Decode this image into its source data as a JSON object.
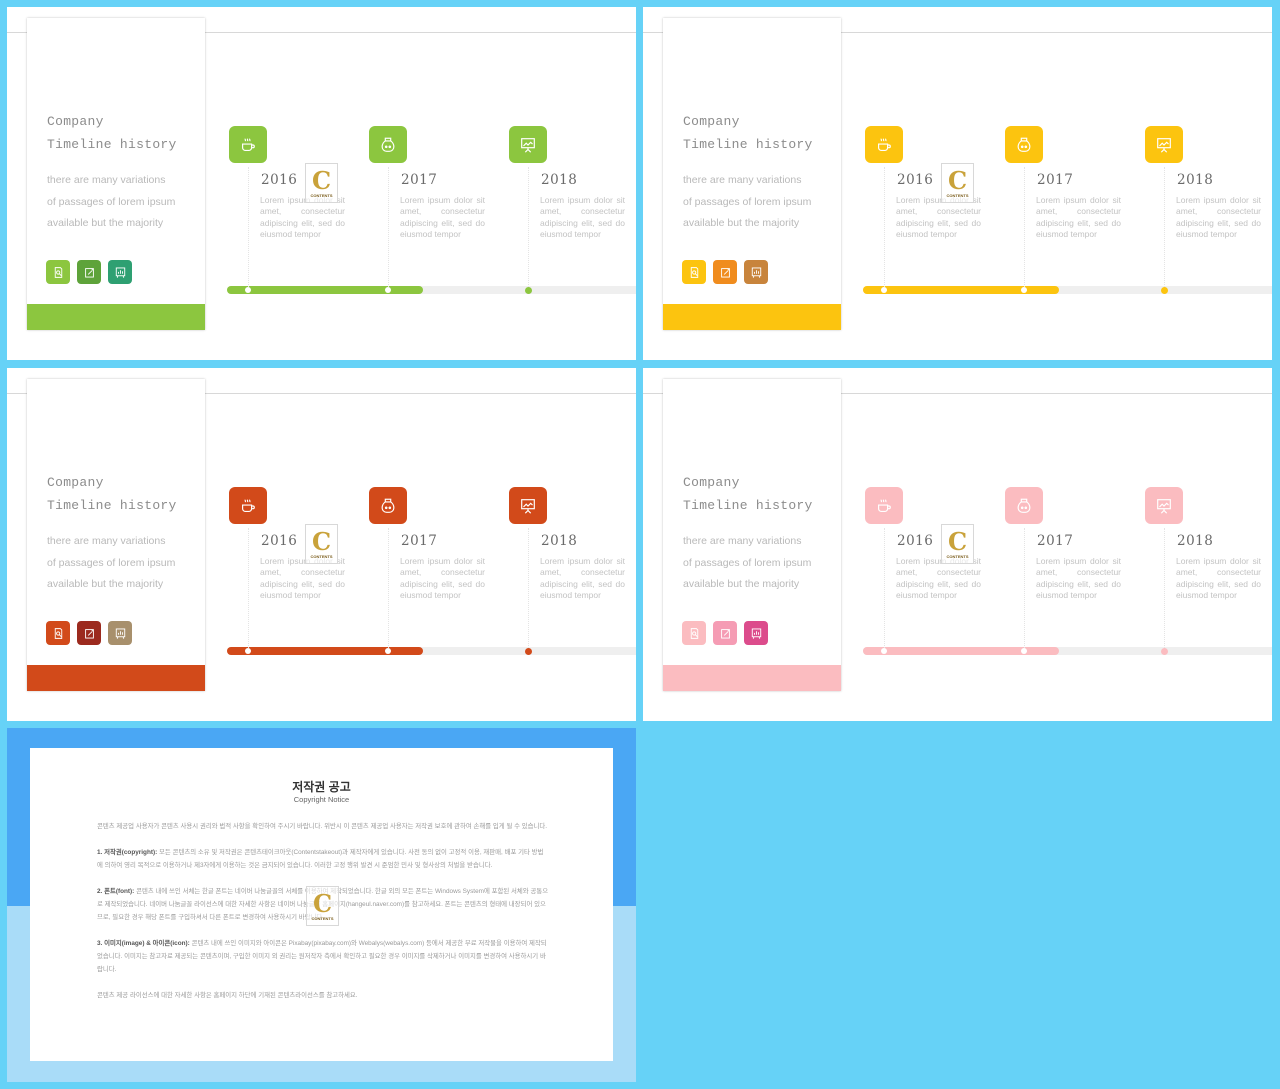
{
  "slides": [
    {
      "theme": "green",
      "accent": "#8cc63f",
      "band_color": "#8cc63f",
      "mini_colors": [
        "#8cc63f",
        "#5ea33a",
        "#2ea072"
      ],
      "title_line1": "Company",
      "title_line2": "Timeline history",
      "description": [
        "there are many variations",
        "of passages of lorem ipsum",
        "available but the majority"
      ],
      "progress_percent": 48,
      "milestones": [
        {
          "year": "2016",
          "icon": "coffee-cup-icon",
          "text": "Lorem ipsum dolor sit amet, consectetur adipiscing elit, sed do eiusmod tempor"
        },
        {
          "year": "2017",
          "icon": "jar-icon",
          "text": "Lorem ipsum dolor sit amet, consectetur adipiscing elit, sed do eiusmod tempor"
        },
        {
          "year": "2018",
          "icon": "presentation-board-icon",
          "text": "Lorem ipsum dolor sit amet, consectetur adipiscing elit, sed do eiusmod tempor"
        }
      ]
    },
    {
      "theme": "yellow",
      "accent": "#fcc40f",
      "band_color": "#fcc40f",
      "mini_colors": [
        "#fcc40f",
        "#f08c1e",
        "#c8843c"
      ],
      "title_line1": "Company",
      "title_line2": "Timeline history",
      "description": [
        "there are many variations",
        "of passages of lorem ipsum",
        "available but the majority"
      ],
      "progress_percent": 48,
      "milestones": [
        {
          "year": "2016",
          "icon": "coffee-cup-icon",
          "text": "Lorem ipsum dolor sit amet, consectetur adipiscing elit, sed do eiusmod tempor"
        },
        {
          "year": "2017",
          "icon": "jar-icon",
          "text": "Lorem ipsum dolor sit amet, consectetur adipiscing elit, sed do eiusmod tempor"
        },
        {
          "year": "2018",
          "icon": "presentation-board-icon",
          "text": "Lorem ipsum dolor sit amet, consectetur adipiscing elit, sed do eiusmod tempor"
        }
      ]
    },
    {
      "theme": "orange-red",
      "accent": "#d24a1a",
      "band_color": "#d24a1a",
      "mini_colors": [
        "#d24a1a",
        "#9c2a1e",
        "#a8906c"
      ],
      "title_line1": "Company",
      "title_line2": "Timeline history",
      "description": [
        "there are many variations",
        "of passages of lorem ipsum",
        "available but the majority"
      ],
      "progress_percent": 48,
      "milestones": [
        {
          "year": "2016",
          "icon": "coffee-cup-icon",
          "text": "Lorem ipsum dolor sit amet, consectetur adipiscing elit, sed do eiusmod tempor"
        },
        {
          "year": "2017",
          "icon": "jar-icon",
          "text": "Lorem ipsum dolor sit amet, consectetur adipiscing elit, sed do eiusmod tempor"
        },
        {
          "year": "2018",
          "icon": "presentation-board-icon",
          "text": "Lorem ipsum dolor sit amet, consectetur adipiscing elit, sed do eiusmod tempor"
        }
      ]
    },
    {
      "theme": "pink",
      "accent": "#fbbcc0",
      "band_color": "#fbbcc0",
      "mini_colors": [
        "#fbbcc0",
        "#f59cb4",
        "#dc4c8c"
      ],
      "title_line1": "Company",
      "title_line2": "Timeline history",
      "description": [
        "there are many variations",
        "of passages of lorem ipsum",
        "available but the majority"
      ],
      "progress_percent": 48,
      "milestones": [
        {
          "year": "2016",
          "icon": "coffee-cup-icon",
          "text": "Lorem ipsum dolor sit amet, consectetur adipiscing elit, sed do eiusmod tempor"
        },
        {
          "year": "2017",
          "icon": "jar-icon",
          "text": "Lorem ipsum dolor sit amet, consectetur adipiscing elit, sed do eiusmod tempor"
        },
        {
          "year": "2018",
          "icon": "presentation-board-icon",
          "text": "Lorem ipsum dolor sit amet, consectetur adipiscing elit, sed do eiusmod tempor"
        }
      ]
    }
  ],
  "watermark": {
    "letter": "C",
    "text": "CONTENTS"
  },
  "copyright": {
    "title": "저작권 공고",
    "subtitle": "Copyright Notice",
    "intro": "콘텐츠 제공업 사용자가 콘텐츠 사용시 권리와 법적 사항을 확인하여 주시기 바랍니다. 위반시 이 콘텐츠 제공업 사용자는 저작권 보호에 관하여 손해를 입게 될 수 있습니다.",
    "sections": [
      {
        "label": "1. 저작권(copyright):",
        "text": "모든 콘텐츠의 소유 및 저작권은 콘텐츠테이크아웃(Contentstakeout)과 제작자에게 있습니다. 사전 동의 없이 고정적 이용, 재판매, 배포 기타 방법에 의하여 영리 목적으로 이용하거나 제3자에게 이용하는 것은 금지되어 있습니다. 이러한 고정 행위 발견 시 준엄한 민사 및 형사상의 처벌을 받습니다."
      },
      {
        "label": "2. 폰트(font):",
        "text": "콘텐츠 내에 쓰인 서체는 한글 폰트는 네이버 나눔글꼴의 서체를 이용하여 제작되었습니다. 한글 외의 모든 폰트는 Windows System에 포함된 서체와 공통으로 제작되었습니다. 네이버 나눔글꼴 라이선스에 대한 자세한 사항은 네이버 나눔글꼴 홈페이지(hangeul.naver.com)를 참고하세요. 폰트는 콘텐츠의 형태에 내장되어 있으므로, 필요한 경우 해당 폰트를 구입하셔서 다른 폰트로 변경하여 사용하시기 바랍니다."
      },
      {
        "label": "3. 이미지(image) & 아이콘(icon):",
        "text": "콘텐츠 내에 쓰인 이미지와 아이콘은 Pixabay(pixabay.com)와 Webalys(webalys.com) 등에서 제공한 무료 저작물을 이용하여 제작되었습니다. 이미지는 참고자료 제공되는 콘텐츠이며, 구입한 이미지 외 권리는 원저작자 측에서 확인하고 필요한 경우 이미지를 삭제하거나 이미지를 변경하여 사용하시기 바랍니다."
      }
    ],
    "footer": "콘텐츠 제공 라이선스에 대한 자세한 사항은 홈페이지 하단에 기재된 콘텐츠라이선스를 참고하세요."
  }
}
